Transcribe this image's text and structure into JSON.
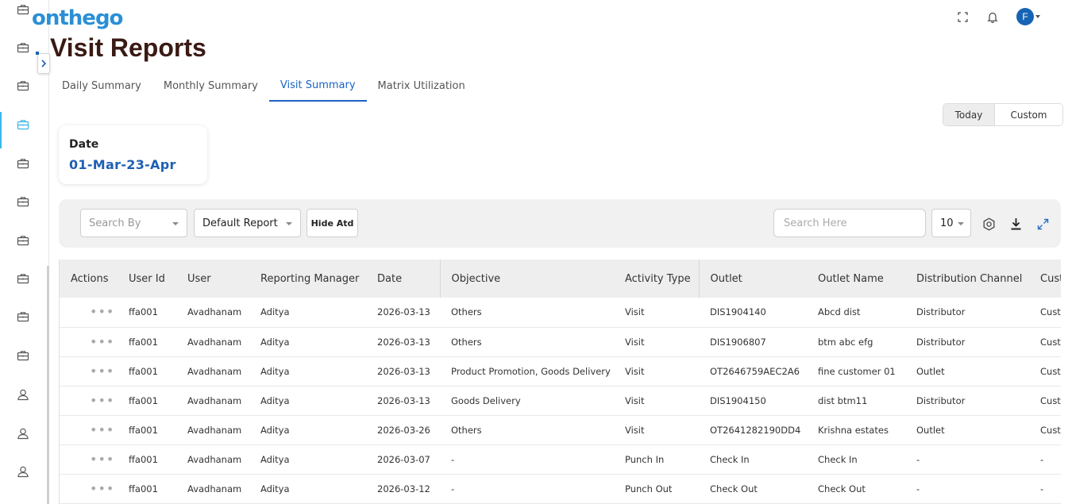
{
  "brand": {
    "logo_text": "onthego"
  },
  "header": {
    "avatar_initial": "F"
  },
  "page": {
    "title": "Visit Reports"
  },
  "tabs": [
    {
      "label": "Daily Summary",
      "active": false
    },
    {
      "label": "Monthly Summary",
      "active": false
    },
    {
      "label": "Visit Summary",
      "active": true
    },
    {
      "label": "Matrix Utilization",
      "active": false
    }
  ],
  "range": {
    "today": "Today",
    "custom": "Custom"
  },
  "date_card": {
    "label": "Date",
    "value": "01-Mar-23-Apr"
  },
  "filters": {
    "search_by_placeholder": "Search By",
    "report_value": "Default Report",
    "hide_atd_label": "Hide Atd",
    "search_placeholder": "Search Here",
    "page_size": "10"
  },
  "table": {
    "columns": [
      "Actions",
      "User Id",
      "User",
      "Reporting Manager",
      "Date",
      "Objective",
      "Activity Type",
      "Outlet",
      "Outlet Name",
      "Distribution Channel",
      "Cust"
    ],
    "rows": [
      [
        "ffa001",
        "Avadhanam",
        "Aditya",
        "2026-03-13",
        "Others",
        "Visit",
        "DIS1904140",
        "Abcd dist",
        "Distributor",
        "Cust"
      ],
      [
        "ffa001",
        "Avadhanam",
        "Aditya",
        "2026-03-13",
        "Others",
        "Visit",
        "DIS1906807",
        "btm abc efg",
        "Distributor",
        "Cust"
      ],
      [
        "ffa001",
        "Avadhanam",
        "Aditya",
        "2026-03-13",
        "Product Promotion, Goods Delivery",
        "Visit",
        "OT2646759AEC2A6",
        "fine customer 01",
        "Outlet",
        "Cust"
      ],
      [
        "ffa001",
        "Avadhanam",
        "Aditya",
        "2026-03-13",
        "Goods Delivery",
        "Visit",
        "DIS1904150",
        "dist btm11",
        "Distributor",
        "Cust"
      ],
      [
        "ffa001",
        "Avadhanam",
        "Aditya",
        "2026-03-26",
        "Others",
        "Visit",
        "OT2641282190DD4",
        "Krishna estates",
        "Outlet",
        "Cust"
      ],
      [
        "ffa001",
        "Avadhanam",
        "Aditya",
        "2026-03-07",
        "-",
        "Punch In",
        "Check In",
        "Check In",
        "-",
        "-"
      ],
      [
        "ffa001",
        "Avadhanam",
        "Aditya",
        "2026-03-12",
        "-",
        "Punch Out",
        "Check Out",
        "Check Out",
        "-",
        "-"
      ]
    ]
  },
  "sidebar": {
    "icons": [
      "briefcase-icon",
      "briefcase-icon",
      "briefcase-icon",
      "briefcase-icon",
      "briefcase-icon",
      "briefcase-icon",
      "briefcase-icon",
      "briefcase-icon",
      "briefcase-icon",
      "briefcase-icon",
      "user-icon",
      "user-icon",
      "user-icon"
    ],
    "active_index": 3
  },
  "colors": {
    "accent": "#1a63c2",
    "logo": "#2a8fd6",
    "title": "#3a1a14"
  }
}
